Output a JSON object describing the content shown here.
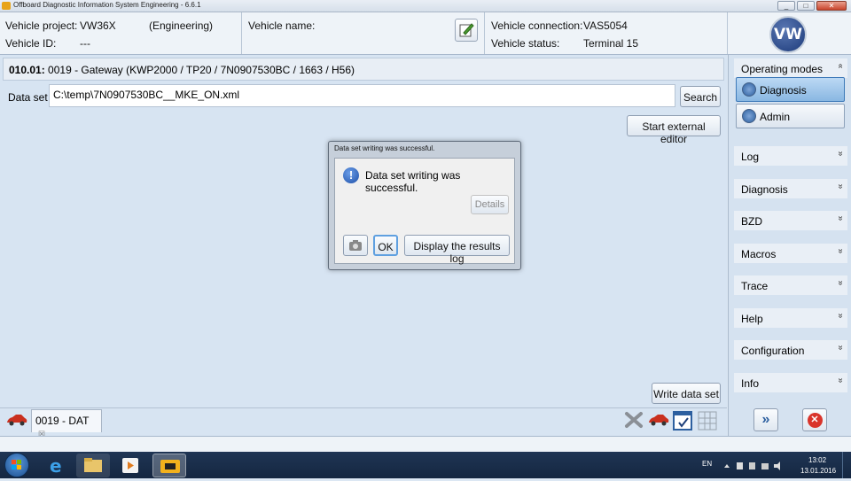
{
  "window": {
    "title": "Offboard Diagnostic Information System Engineering - 6.6.1",
    "minimize": "_",
    "maximize": "□",
    "close": "✕"
  },
  "header": {
    "vehicle_project_label": "Vehicle project:",
    "vehicle_project": "VW36X",
    "mode": "(Engineering)",
    "vehicle_id_label": "Vehicle ID:",
    "vehicle_id": "---",
    "vehicle_name_label": "Vehicle name:",
    "vehicle_connection_label": "Vehicle connection:",
    "vehicle_connection": "VAS5054",
    "vehicle_status_label": "Vehicle status:",
    "vehicle_status": "Terminal 15",
    "logo_text": "VW"
  },
  "ecu": {
    "address": "010.01:",
    "description": "0019 - Gateway  (KWP2000 / TP20 / 7N0907530BC / 1663 / H56)"
  },
  "dataset": {
    "label": "Data set",
    "path": "C:\\temp\\7N0907530BC__MKE_ON.xml",
    "search": "Search",
    "external_editor": "Start external editor"
  },
  "write_button": "Write data set",
  "tab": {
    "label": "0019 - DAT",
    "close": "☒"
  },
  "sidebar": {
    "operating_modes": "Operating modes",
    "modes": [
      {
        "label": "Diagnosis"
      },
      {
        "label": "Admin"
      }
    ],
    "sections": [
      "Log",
      "Diagnosis",
      "BZD",
      "Macros",
      "Trace",
      "Help",
      "Configuration",
      "Info"
    ],
    "chevron": "»"
  },
  "bottom_icons": {
    "next": "»",
    "cancel": "✕"
  },
  "dialog": {
    "title": "Data set writing was successful.",
    "message": "Data set writing was successful.",
    "details": "Details",
    "ok": "OK",
    "results_log": "Display the results log",
    "info_glyph": "!"
  },
  "taskbar": {
    "language": "EN",
    "time": "13:02",
    "date": "13.01.2016"
  },
  "colors": {
    "accent": "#2c5f9f",
    "selected_mode": "#9fc6ec",
    "taskbar": "#1f3554"
  }
}
